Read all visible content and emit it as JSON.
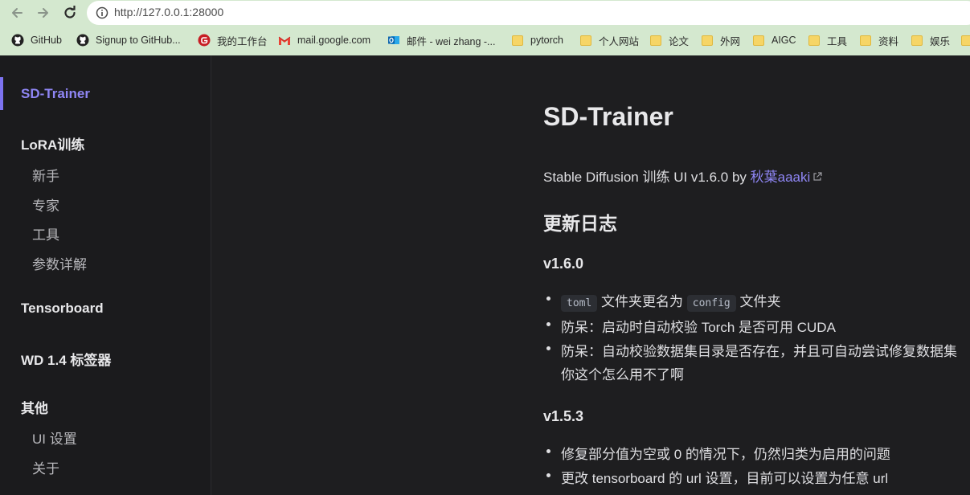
{
  "browser": {
    "url": "http://127.0.0.1:28000",
    "bookmarks": [
      {
        "label": "GitHub",
        "icon": "github-icon"
      },
      {
        "label": "Signup to GitHub...",
        "icon": "github-icon"
      },
      {
        "label": "我的工作台",
        "icon": "gitee-icon"
      },
      {
        "label": "mail.google.com",
        "icon": "gmail-icon"
      },
      {
        "label": "邮件 - wei zhang -...",
        "icon": "outlook-icon"
      },
      {
        "label": "pytorch",
        "icon": "folder-icon"
      },
      {
        "label": "个人网站",
        "icon": "folder-icon"
      },
      {
        "label": "论文",
        "icon": "folder-icon"
      },
      {
        "label": "外网",
        "icon": "folder-icon"
      },
      {
        "label": "AIGC",
        "icon": "folder-icon"
      },
      {
        "label": "工具",
        "icon": "folder-icon"
      },
      {
        "label": "资料",
        "icon": "folder-icon"
      },
      {
        "label": "娱乐",
        "icon": "folder-icon"
      }
    ]
  },
  "sidebar": {
    "title": "SD-Trainer",
    "lora_section": "LoRA训练",
    "lora_items": [
      "新手",
      "专家",
      "工具",
      "参数详解"
    ],
    "tensorboard": "Tensorboard",
    "tagger": "WD 1.4 标签器",
    "other_section": "其他",
    "other_items": [
      "UI 设置",
      "关于"
    ]
  },
  "main": {
    "title": "SD-Trainer",
    "subtitle_prefix": "Stable Diffusion 训练 UI v1.6.0 by ",
    "author": "秋葉aaaki",
    "changelog_title": "更新日志",
    "v160": {
      "version": "v1.6.0",
      "item1_code1": "toml",
      "item1_mid": " 文件夹更名为 ",
      "item1_code2": "config",
      "item1_end": " 文件夹",
      "item2": "防呆：启动时自动校验 Torch 是否可用 CUDA",
      "item3": "防呆：自动校验数据集目录是否存在，并且可自动尝试修复数据集",
      "item3_cont": "你这个怎么用不了啊"
    },
    "v153": {
      "version": "v1.5.3",
      "item1": "修复部分值为空或 0 的情况下，仍然归类为启用的问题",
      "item2": "更改 tensorboard 的 url 设置，目前可以设置为任意 url"
    }
  },
  "colors": {
    "accent": "#8f86f5",
    "background": "#1e1e20",
    "sidebar": "#1b1b1d",
    "chrome": "#d4e8cf"
  }
}
